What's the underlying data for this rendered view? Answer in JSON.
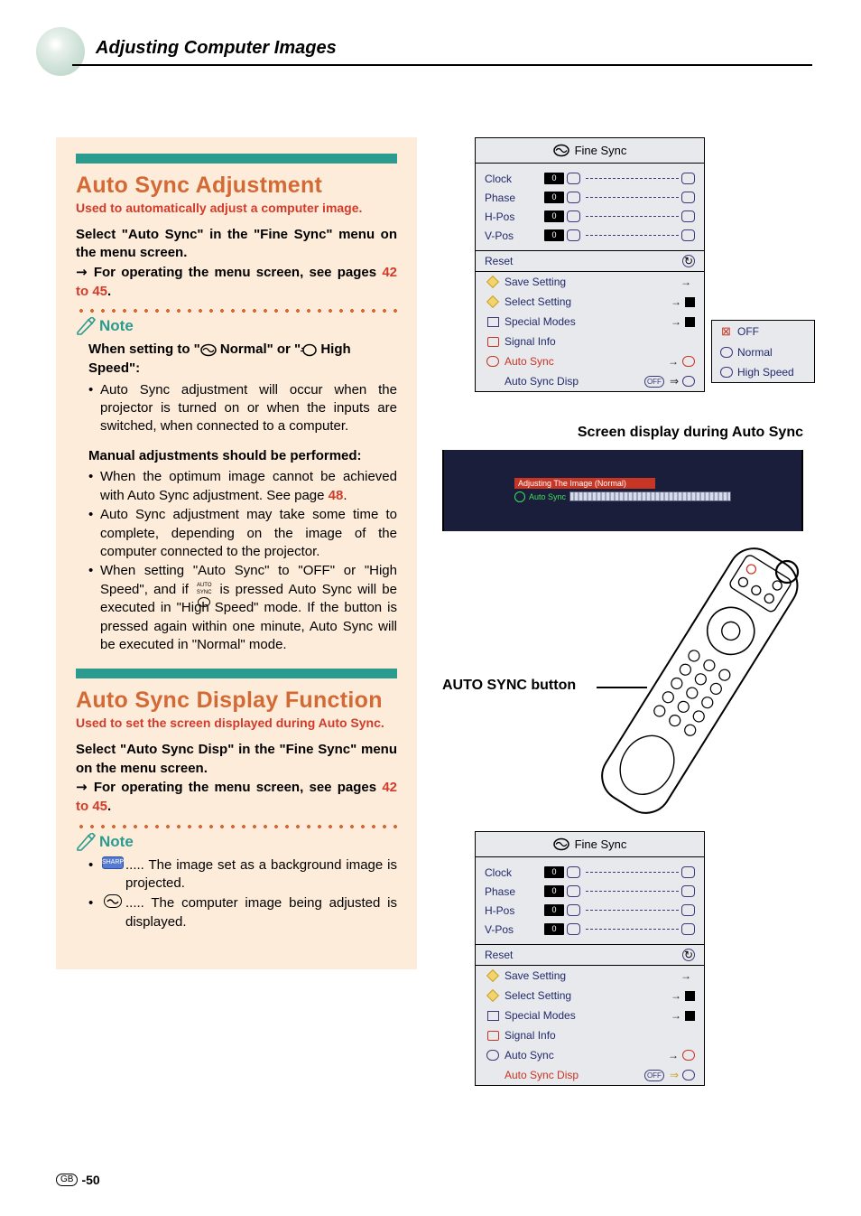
{
  "header": {
    "title": "Adjusting Computer Images"
  },
  "page": {
    "region": "GB",
    "number": "-50"
  },
  "section1": {
    "title": "Auto Sync Adjustment",
    "intro": "Used to automatically adjust a computer image.",
    "instr1": "Select \"Auto Sync\" in the \"Fine Sync\" menu on the menu screen.",
    "instr2_a": "For operating the menu screen, see pages ",
    "instr2_b": "42 to 45",
    "instr2_c": ".",
    "note_label": "Note",
    "note_head_a": "When setting to \"",
    "note_head_b": " Normal\" or \"",
    "note_head_c": " High Speed\":",
    "note_bullet1": "Auto Sync adjustment will occur when the projector is turned on or when the inputs are switched, when connected to a computer.",
    "manual_head": "Manual adjustments should be performed:",
    "manual_b1_a": "When the optimum image cannot be achieved with Auto Sync adjustment. See page ",
    "manual_b1_b": "48",
    "manual_b1_c": ".",
    "manual_b2": "Auto Sync adjustment may take some time to complete, depending on the image of the computer connected to the projector.",
    "manual_b3_a": "When setting \"Auto Sync\" to \"OFF\" or \"High Speed\", and if ",
    "manual_b3_label": "AUTO SYNC",
    "manual_b3_b": " is pressed Auto Sync will be executed in \"High Speed\" mode. If the button is pressed again within one minute, Auto Sync will be executed in \"Normal\" mode."
  },
  "section2": {
    "title": "Auto Sync Display Function",
    "intro": "Used to set the screen displayed during Auto Sync.",
    "instr1": "Select \"Auto Sync Disp\" in the \"Fine Sync\" menu on the menu screen.",
    "instr2_a": "For operating the menu screen, see pages ",
    "instr2_b": "42 to 45",
    "instr2_c": ".",
    "note_label": "Note",
    "note1_icon_label": "SHARP",
    "note1_text": "..... The image set as a background image is projected.",
    "note2_text": "..... The computer image being adjusted is displayed."
  },
  "menu": {
    "title": "Fine Sync",
    "rows": {
      "clock": "Clock",
      "phase": "Phase",
      "hpos": "H-Pos",
      "vpos": "V-Pos",
      "value": "0"
    },
    "reset": "Reset",
    "save": "Save Setting",
    "select": "Select Setting",
    "special": "Special Modes",
    "signal": "Signal Info",
    "autosync": "Auto Sync",
    "autosyncdisp": "Auto Sync Disp",
    "pill_off": "OFF"
  },
  "options": {
    "off": "OFF",
    "normal": "Normal",
    "highspeed": "High Speed"
  },
  "screendisplay": {
    "caption": "Screen display during Auto Sync",
    "bar_title": "Adjusting The Image (Normal)",
    "bar_label": "Auto Sync"
  },
  "remote": {
    "caption": "AUTO SYNC button"
  }
}
